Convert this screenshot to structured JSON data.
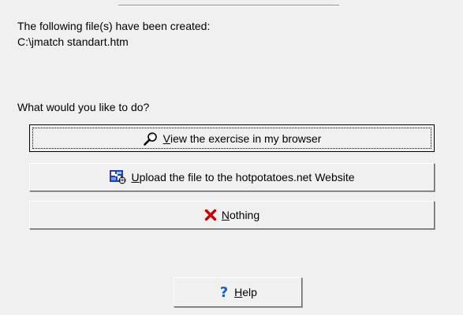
{
  "message": {
    "created_line": "The following file(s) have been created:",
    "file_path": "C:\\jmatch standart.htm"
  },
  "prompt": "What would you like to do?",
  "buttons": {
    "view": {
      "icon": "magnifier-icon",
      "mnemonic": "V",
      "rest": "iew the exercise in my browser"
    },
    "upload": {
      "icon": "hotpotatoes-web-icon",
      "mnemonic": "U",
      "rest": "pload the file to the hotpotatoes.net Website"
    },
    "nothing": {
      "icon": "red-x-icon",
      "mnemonic": "N",
      "rest": "othing"
    },
    "help": {
      "icon": "help-question-icon",
      "mnemonic": "H",
      "rest": "elp"
    }
  },
  "colors": {
    "background": "#f0f0f0",
    "nothing_icon": "#cc0000",
    "help_icon": "#1f5fbf"
  }
}
